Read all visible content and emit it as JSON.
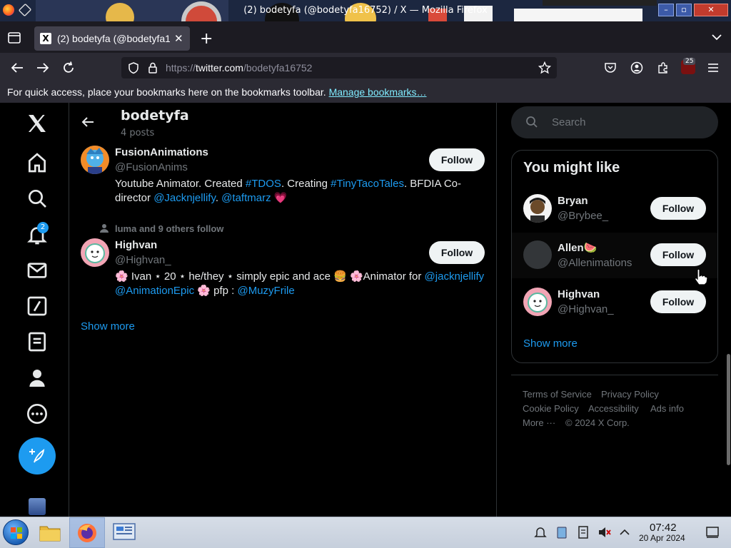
{
  "window": {
    "title": "(2) bodetyfa (@bodetyfa16752) / X — Mozilla Firefox",
    "minimize": "–",
    "maximize": "▫",
    "close": "✕"
  },
  "tab": {
    "label": "(2) bodetyfa (@bodetyfa16752) / X",
    "favicon": "X",
    "close": "✕",
    "new_tab": "+"
  },
  "nav": {
    "url_prefix": "https://",
    "url_domain": "twitter.com",
    "url_path": "/bodetyfa16752",
    "extensions_badge": "25"
  },
  "bookmarks_bar": {
    "message": "For quick access, place your bookmarks here on the bookmarks toolbar.",
    "link": "Manage bookmarks…"
  },
  "sidebar": {
    "notification_count": "2"
  },
  "profile_header": {
    "name": "bodetyfa",
    "post_count": "4 posts"
  },
  "following_list": [
    {
      "name": "FusionAnimations",
      "handle": "@FusionAnims",
      "follow_label": "Follow",
      "bio_parts": [
        {
          "t": "Youtube Animator. Created ",
          "link": false
        },
        {
          "t": "#TDOS",
          "link": true
        },
        {
          "t": ". Creating ",
          "link": false
        },
        {
          "t": "#TinyTacoTales",
          "link": true
        },
        {
          "t": ". BFDIA Co-director ",
          "link": false
        },
        {
          "t": "@Jacknjellify",
          "link": true
        },
        {
          "t": ". ",
          "link": false
        },
        {
          "t": "@taftmarz",
          "link": true
        },
        {
          "t": " 💗",
          "link": false
        }
      ]
    },
    {
      "followed_by": "luma and 9 others follow",
      "name": "Highvan",
      "handle": "@Highvan_",
      "follow_label": "Follow",
      "bio_parts": [
        {
          "t": "🌸 Ivan ⋆ 20 ⋆ he/they ⋆ simply epic and ace 🍔 🌸Animator for ",
          "link": false
        },
        {
          "t": "@jacknjellify",
          "link": true
        },
        {
          "t": " ",
          "link": false
        },
        {
          "t": "@AnimationEpic",
          "link": true
        },
        {
          "t": " 🌸 pfp : ",
          "link": false
        },
        {
          "t": "@MuzyFrile",
          "link": true
        }
      ]
    }
  ],
  "main_show_more": "Show more",
  "search": {
    "placeholder": "Search"
  },
  "who_to_follow": {
    "title": "You might like",
    "users": [
      {
        "name": "Bryan",
        "handle": "@Brybee_",
        "follow_label": "Follow"
      },
      {
        "name": "Allen🍉",
        "handle": "@Allenimations",
        "follow_label": "Follow"
      },
      {
        "name": "Highvan",
        "handle": "@Highvan_",
        "follow_label": "Follow"
      }
    ],
    "show_more": "Show more"
  },
  "footer": {
    "terms": "Terms of Service",
    "privacy": "Privacy Policy",
    "cookie": "Cookie Policy",
    "accessibility": "Accessibility",
    "ads": "Ads info",
    "more": "More ···",
    "copyright": "© 2024 X Corp."
  },
  "taskbar": {
    "time": "07:42",
    "date": "20 Apr 2024"
  },
  "colors": {
    "accent": "#1d9bf0",
    "background": "#000000",
    "text_primary": "#e7e9ea",
    "text_secondary": "#71767b"
  }
}
